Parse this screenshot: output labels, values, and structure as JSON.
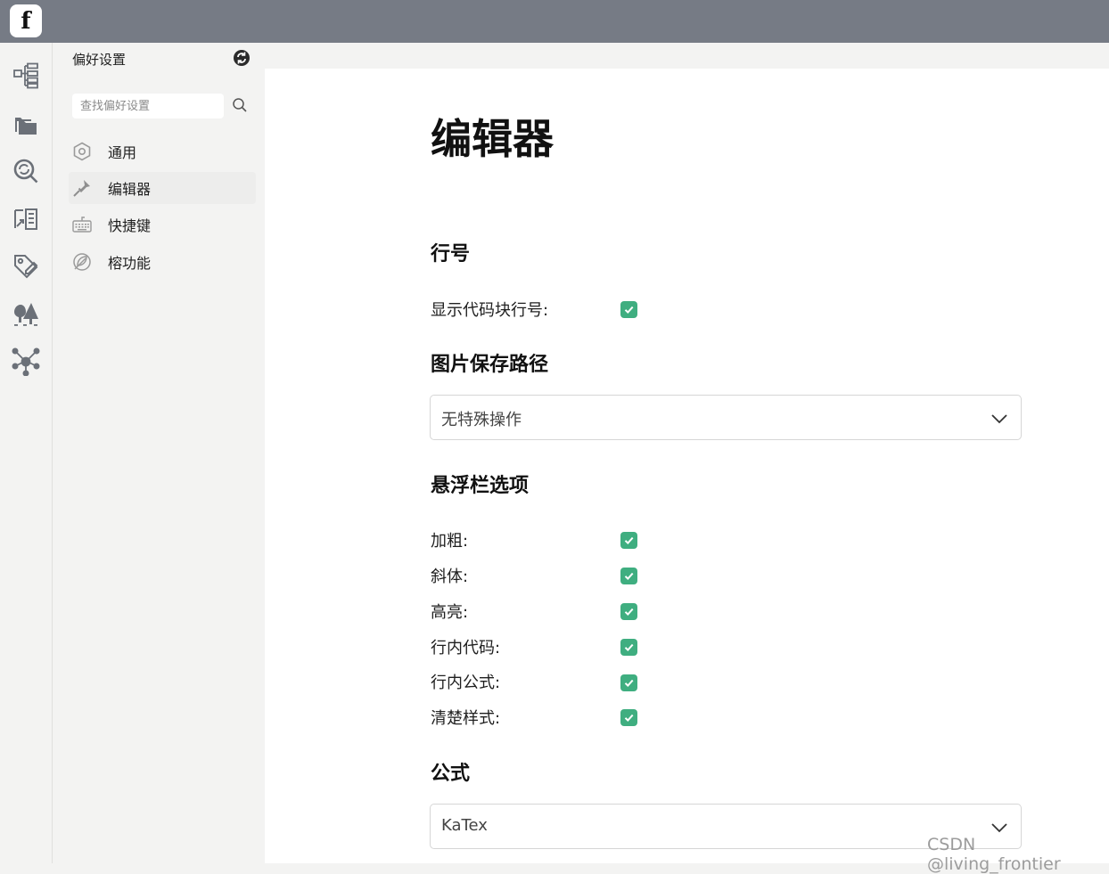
{
  "app": {
    "logo_letter": "f"
  },
  "sidebar_rail": {
    "items": [
      {
        "icon": "outline-tree-icon"
      },
      {
        "icon": "folders-icon"
      },
      {
        "icon": "search-sync-icon"
      },
      {
        "icon": "document-list-icon"
      },
      {
        "icon": "tag-edit-icon"
      },
      {
        "icon": "forest-icon"
      },
      {
        "icon": "graph-network-icon"
      }
    ]
  },
  "settings_panel": {
    "title": "偏好设置",
    "search_placeholder": "查找偏好设置",
    "items": [
      {
        "label": "通用",
        "icon": "hexagon-gear-icon",
        "active": false
      },
      {
        "label": "编辑器",
        "icon": "pen-nib-icon",
        "active": true
      },
      {
        "label": "快捷键",
        "icon": "keyboard-icon",
        "active": false
      },
      {
        "label": "榕功能",
        "icon": "compass-leaf-icon",
        "active": false
      }
    ]
  },
  "editor": {
    "title": "编辑器",
    "line_numbers": {
      "heading": "行号",
      "show_code_line_numbers_label": "显示代码块行号:",
      "show_code_line_numbers": true
    },
    "image_path": {
      "heading": "图片保存路径",
      "selected": "无特殊操作"
    },
    "floating_bar": {
      "heading": "悬浮栏选项",
      "options": [
        {
          "label": "加粗:",
          "checked": true
        },
        {
          "label": "斜体:",
          "checked": true
        },
        {
          "label": "高亮:",
          "checked": true
        },
        {
          "label": "行内代码:",
          "checked": true
        },
        {
          "label": "行内公式:",
          "checked": true
        },
        {
          "label": "清楚样式:",
          "checked": true
        }
      ]
    },
    "formula": {
      "heading": "公式",
      "selected": "KaTex"
    }
  },
  "watermark": "CSDN @living_frontier",
  "colors": {
    "topbar": "#767b85",
    "checkbox_checked": "#3fae80",
    "panel_bg": "#f3f3f2",
    "content_bg": "#ffffff"
  }
}
